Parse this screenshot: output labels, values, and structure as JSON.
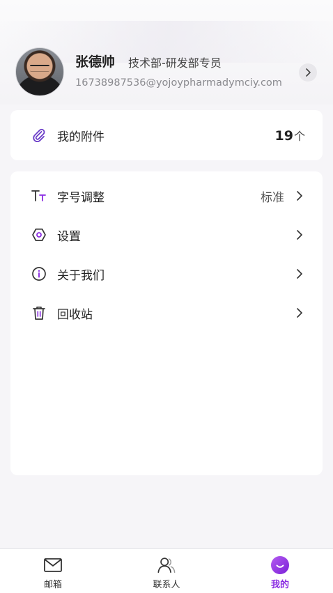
{
  "profile": {
    "name": "张德帅",
    "department": "技术部-研发部专员",
    "email": "16738987536@yojoypharmadymciy.com"
  },
  "attachments": {
    "label": "我的附件",
    "count": "19",
    "unit": "个"
  },
  "menu": {
    "items": [
      {
        "label": "字号调整",
        "value": "标准",
        "icon": "font-size-icon"
      },
      {
        "label": "设置",
        "icon": "settings-icon"
      },
      {
        "label": "关于我们",
        "icon": "info-icon"
      },
      {
        "label": "回收站",
        "icon": "trash-icon"
      }
    ]
  },
  "tabbar": {
    "tabs": [
      {
        "label": "邮箱",
        "icon": "mail-icon",
        "active": false
      },
      {
        "label": "联系人",
        "icon": "contacts-icon",
        "active": false
      },
      {
        "label": "我的",
        "icon": "profile-icon",
        "active": true
      }
    ]
  },
  "colors": {
    "accent": "#8a2be2",
    "accent_soft": "#a259e6"
  }
}
